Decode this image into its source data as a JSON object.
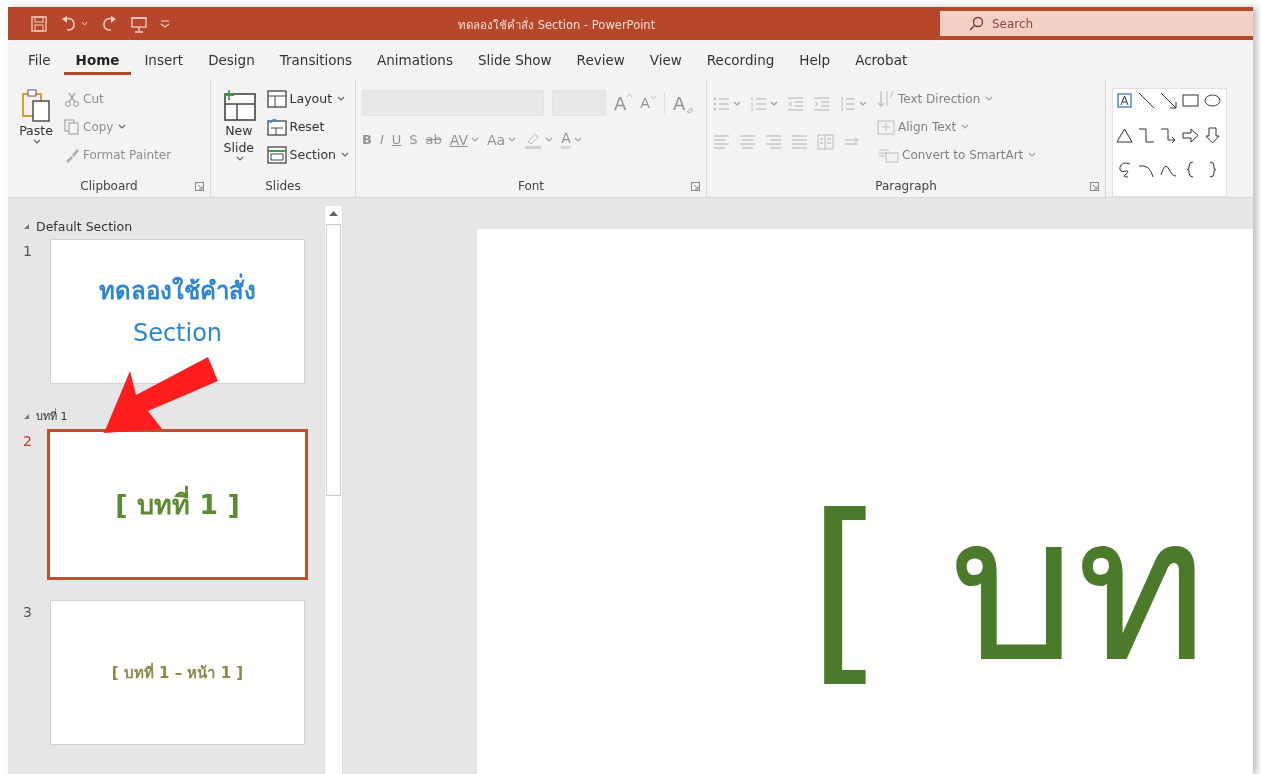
{
  "window": {
    "title": "ทดลองใช้คำสั่ง Section  -  PowerPoint",
    "search": {
      "placeholder": "Search"
    }
  },
  "quick_access": [
    {
      "kind": "save"
    },
    {
      "kind": "undo",
      "dropdown": true
    },
    {
      "kind": "redo"
    },
    {
      "kind": "present"
    },
    {
      "kind": "customize"
    }
  ],
  "tabs": [
    {
      "label": "File",
      "selected": false
    },
    {
      "label": "Home",
      "selected": true
    },
    {
      "label": "Insert",
      "selected": false
    },
    {
      "label": "Design",
      "selected": false
    },
    {
      "label": "Transitions",
      "selected": false
    },
    {
      "label": "Animations",
      "selected": false
    },
    {
      "label": "Slide Show",
      "selected": false
    },
    {
      "label": "Review",
      "selected": false
    },
    {
      "label": "View",
      "selected": false
    },
    {
      "label": "Recording",
      "selected": false
    },
    {
      "label": "Help",
      "selected": false
    },
    {
      "label": "Acrobat",
      "selected": false
    }
  ],
  "ribbon": {
    "groups": [
      {
        "kind": "clipboard",
        "label": "Clipboard",
        "launcher": true,
        "large": {
          "label": "Paste",
          "dropdown": true,
          "disabled": false
        },
        "small": [
          {
            "label": "Cut",
            "dropdown": false,
            "disabled": true
          },
          {
            "label": "Copy",
            "dropdown": true,
            "disabled": true
          },
          {
            "label": "Format Painter",
            "dropdown": false,
            "disabled": true
          }
        ]
      },
      {
        "kind": "slides",
        "label": "Slides",
        "launcher": false,
        "large": {
          "label": "New Slide",
          "dropdown": true,
          "disabled": false
        },
        "small": [
          {
            "label": "Layout",
            "dropdown": true,
            "disabled": false
          },
          {
            "label": "Reset",
            "dropdown": false,
            "disabled": false
          },
          {
            "label": "Section",
            "dropdown": true,
            "disabled": false
          }
        ]
      },
      {
        "kind": "font",
        "label": "Font",
        "launcher": true,
        "disabled": true,
        "row1": [
          {
            "kind": "grow",
            "text": "A"
          },
          {
            "kind": "shrink",
            "text": "A"
          },
          {
            "kind": "clear",
            "text": "A"
          }
        ],
        "row2": [
          {
            "kind": "bold",
            "text": "B"
          },
          {
            "kind": "italic",
            "text": "I"
          },
          {
            "kind": "underline",
            "text": "U"
          },
          {
            "kind": "shadow",
            "text": "S"
          },
          {
            "kind": "strike",
            "text": "ab"
          },
          {
            "kind": "spacing",
            "text": "AV",
            "dropdown": true
          },
          {
            "kind": "case",
            "text": "Aa",
            "dropdown": true
          },
          {
            "kind": "highlight",
            "dropdown": true
          },
          {
            "kind": "color",
            "text": "A",
            "dropdown": true
          }
        ]
      },
      {
        "kind": "paragraph",
        "label": "Paragraph",
        "launcher": true,
        "disabled": true,
        "row1": [
          {
            "kind": "bullets",
            "dropdown": true
          },
          {
            "kind": "numbering",
            "dropdown": true
          },
          {
            "kind": "outdent"
          },
          {
            "kind": "indent"
          },
          {
            "kind": "spacing",
            "dropdown": true
          }
        ],
        "row2": [
          {
            "kind": "left"
          },
          {
            "kind": "center"
          },
          {
            "kind": "right"
          },
          {
            "kind": "justify"
          },
          {
            "kind": "columns"
          },
          {
            "kind": "direction"
          }
        ],
        "small": [
          {
            "label": "Text Direction",
            "dropdown": true
          },
          {
            "label": "Align Text",
            "dropdown": true
          },
          {
            "label": "Convert to SmartArt",
            "dropdown": true
          }
        ]
      },
      {
        "kind": "shapes"
      }
    ]
  },
  "slide_pane": {
    "sections": [
      {
        "name": "Default Section",
        "expanded": true,
        "slides": [
          {
            "number": "1",
            "kind": "title",
            "lines": [
              "ทดลองใช้คำสั่ง",
              "Section"
            ],
            "selected": false
          }
        ]
      },
      {
        "name": "บทที่ 1",
        "expanded": true,
        "slides": [
          {
            "number": "2",
            "kind": "chapter",
            "lines": [
              "[ บทที่ 1 ]"
            ],
            "selected": true
          },
          {
            "number": "3",
            "kind": "page",
            "lines": [
              "[ บทที่ 1 – หน้า 1 ]"
            ],
            "selected": false
          }
        ]
      }
    ]
  },
  "editor": {
    "text": "[ บท"
  },
  "annotation": {
    "kind": "arrow"
  }
}
